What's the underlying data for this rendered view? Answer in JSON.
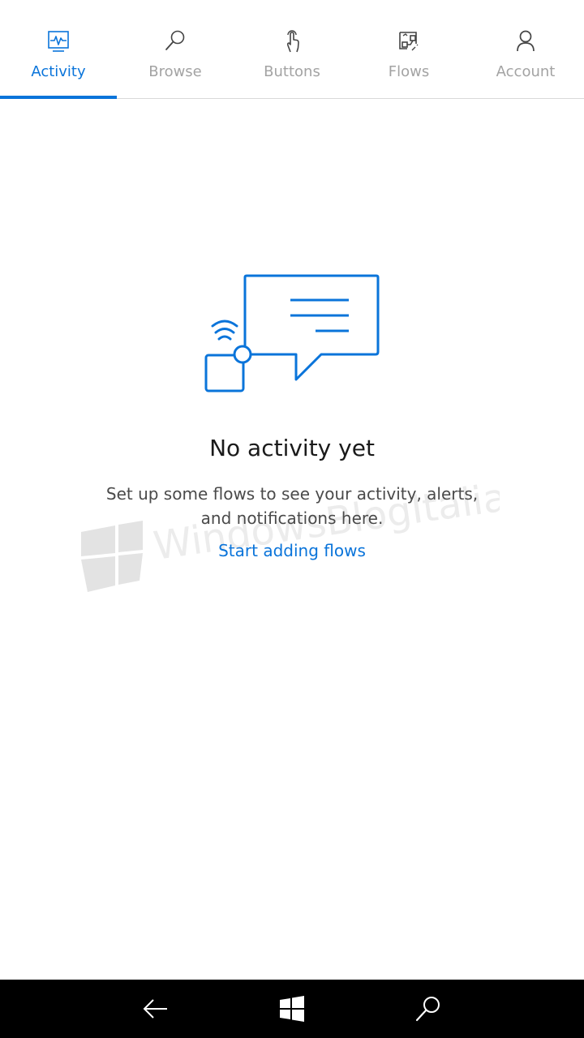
{
  "tabs": [
    {
      "label": "Activity",
      "icon": "activity-icon",
      "active": true
    },
    {
      "label": "Browse",
      "icon": "search-icon",
      "active": false
    },
    {
      "label": "Buttons",
      "icon": "touch-icon",
      "active": false
    },
    {
      "label": "Flows",
      "icon": "flows-icon",
      "active": false
    },
    {
      "label": "Account",
      "icon": "person-icon",
      "active": false
    }
  ],
  "empty_state": {
    "title": "No activity yet",
    "body": "Set up some flows to see your activity, alerts, and notifications here.",
    "link": "Start adding flows"
  },
  "watermark": {
    "text": "WindowsBlogItalia"
  },
  "system_nav": {
    "icons": [
      "back-arrow-icon",
      "windows-logo-icon",
      "search-icon"
    ]
  },
  "colors": {
    "accent": "#0a74da",
    "inactive": "#a3a3a3",
    "nav_background": "#000000"
  }
}
